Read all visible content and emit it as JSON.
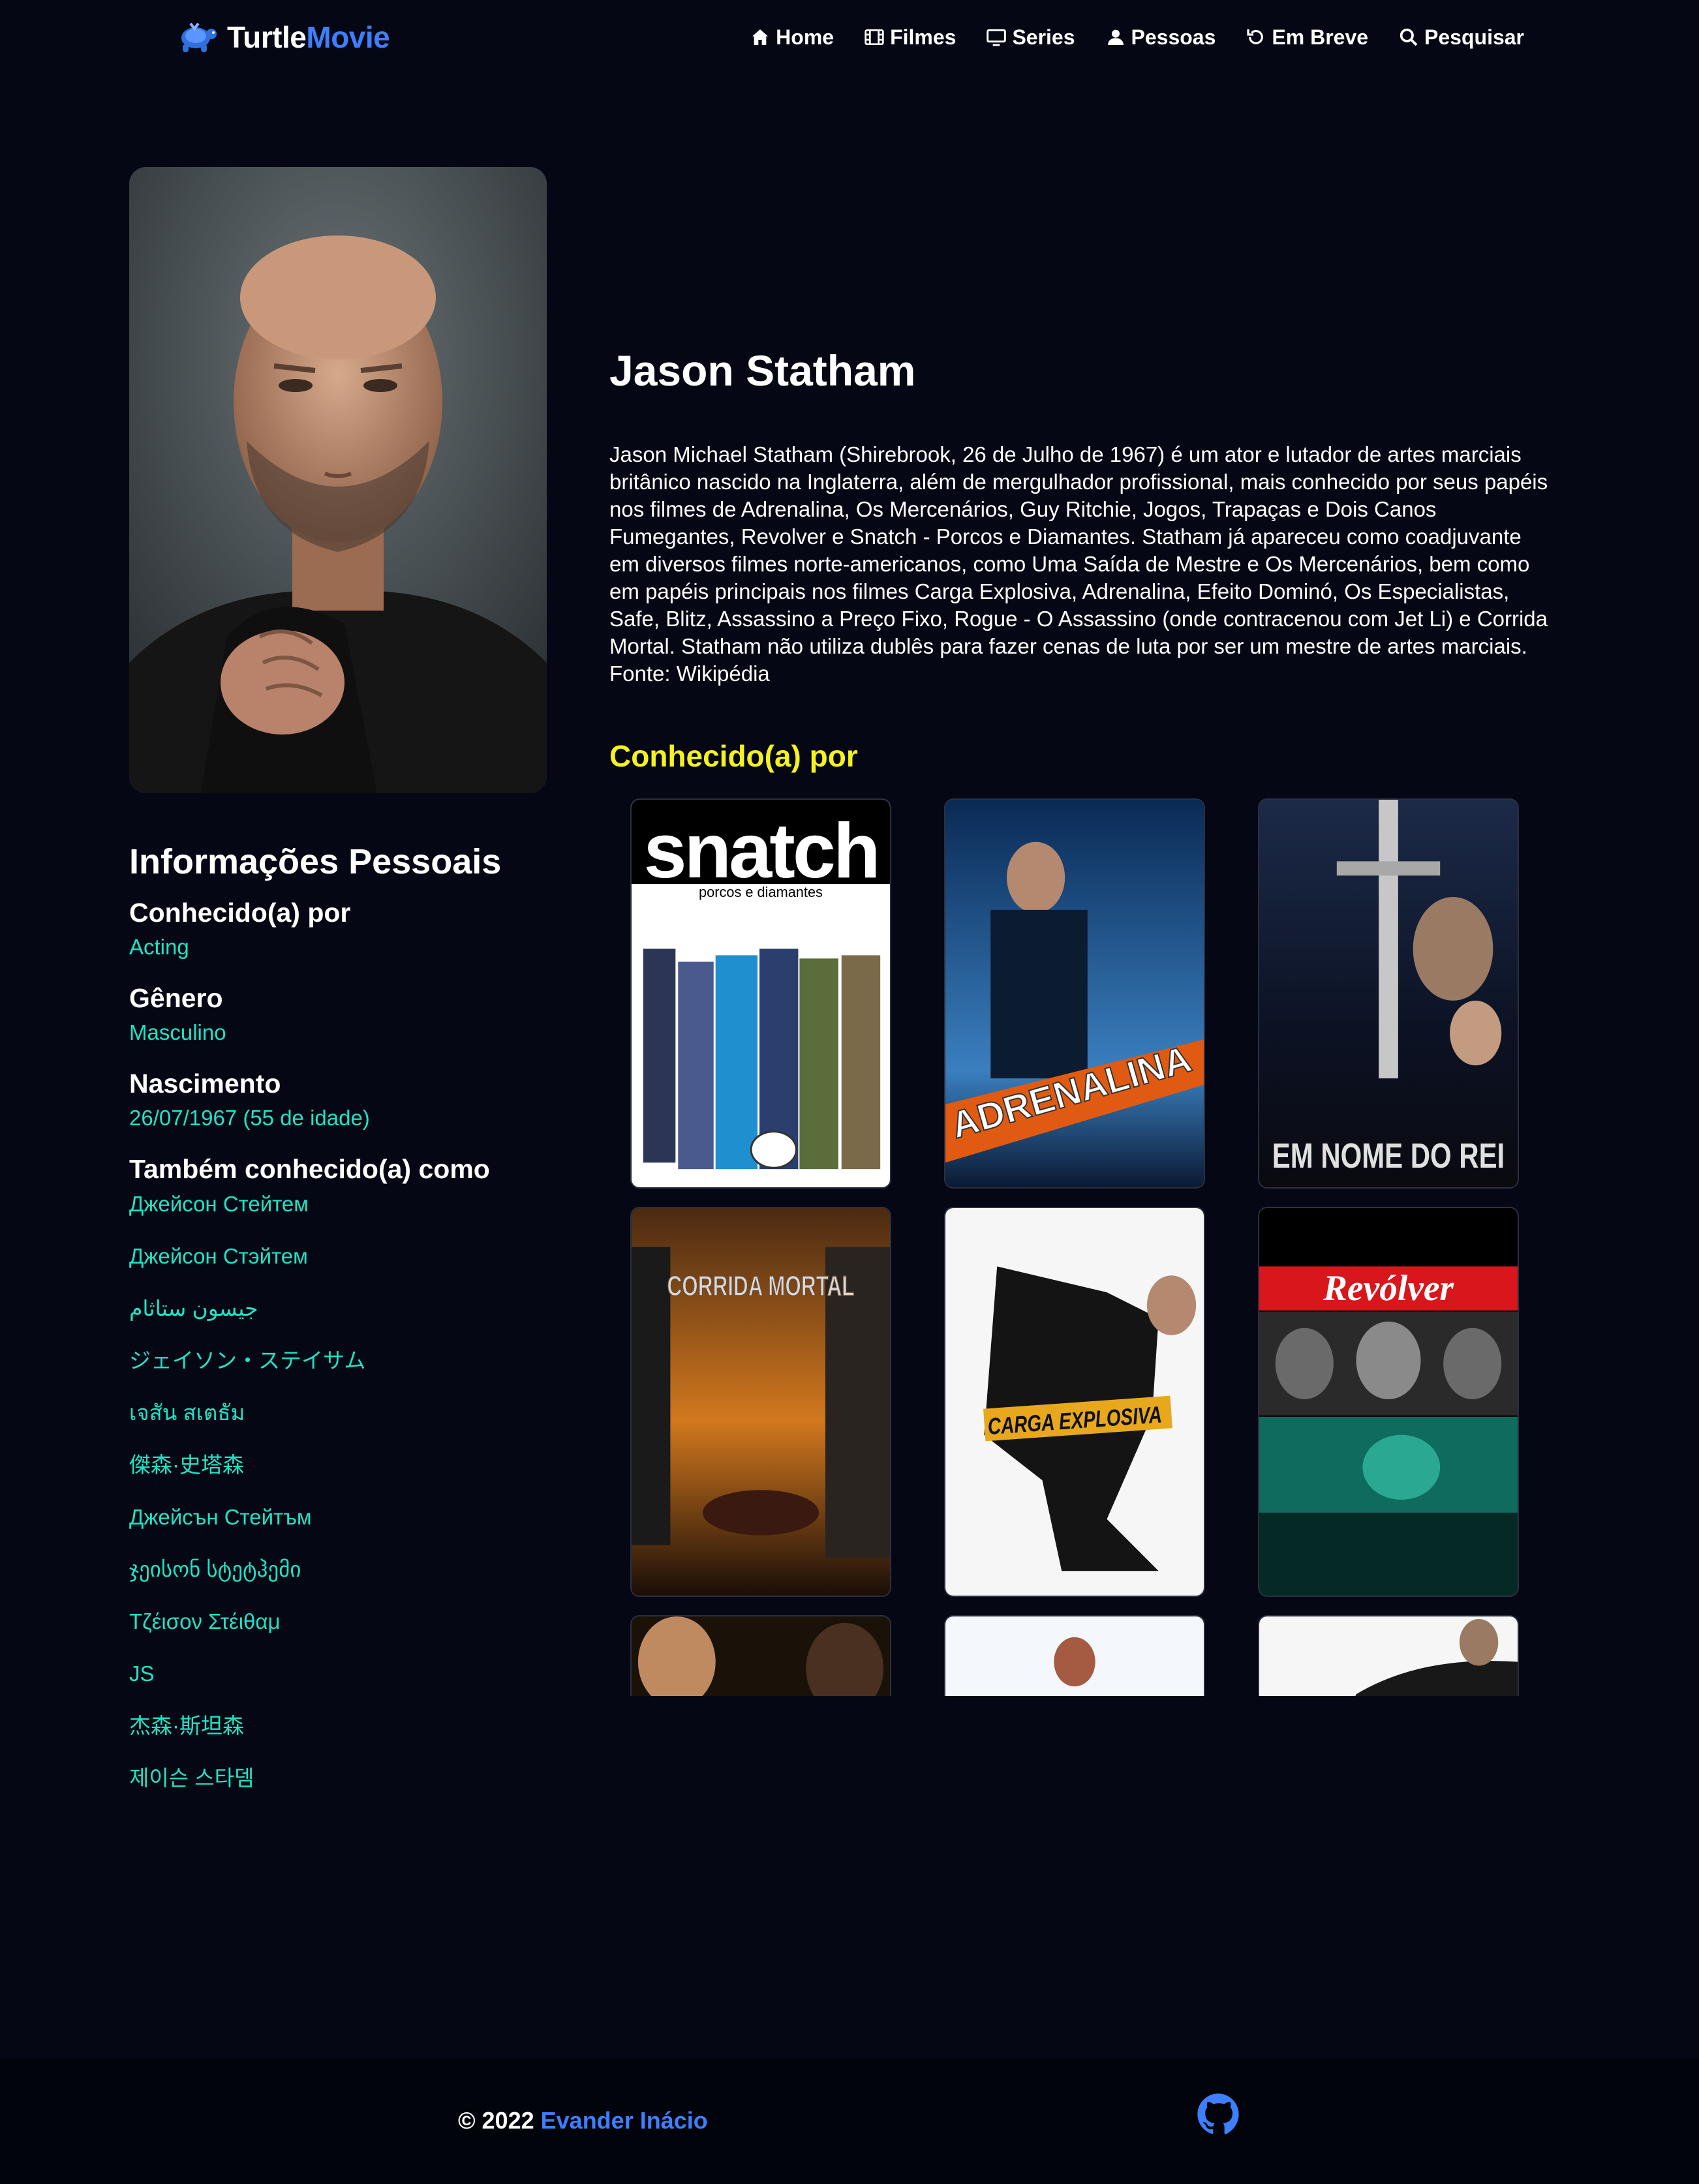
{
  "nav": {
    "logo_part1": "Turtle",
    "logo_part2": "Movie",
    "items": [
      {
        "label": "Home",
        "icon": "home-icon"
      },
      {
        "label": "Filmes",
        "icon": "film-icon"
      },
      {
        "label": "Series",
        "icon": "tv-icon"
      },
      {
        "label": "Pessoas",
        "icon": "person-icon"
      },
      {
        "label": "Em Breve",
        "icon": "history-icon"
      },
      {
        "label": "Pesquisar",
        "icon": "search-icon"
      }
    ]
  },
  "person": {
    "name": "Jason Statham",
    "bio": "Jason Michael Statham (Shirebrook, 26 de Julho de 1967) é um ator e lutador de artes marciais britânico nascido na Inglaterra, além de mergulhador profissional, mais conhecido por seus papéis nos filmes de Adrenalina, Os Mercenários, Guy Ritchie, Jogos, Trapaças e Dois Canos Fumegantes, Revolver e Snatch - Porcos e Diamantes. Statham já apareceu como coadjuvante em diversos filmes norte-americanos, como Uma Saída de Mestre e Os Mercenários, bem como em papéis principais nos filmes Carga Explosiva, Adrenalina, Efeito Dominó, Os Especialistas, Safe, Blitz, Assassino a Preço Fixo, Rogue - O Assassino (onde contracenou com Jet Li) e Corrida Mortal. Statham não utiliza dublês para fazer cenas de luta por ser um mestre de artes marciais. Fonte: Wikipédia"
  },
  "personal_info": {
    "heading": "Informações Pessoais",
    "known_for_label": "Conhecido(a) por",
    "known_for_value": "Acting",
    "gender_label": "Gênero",
    "gender_value": "Masculino",
    "birth_label": "Nascimento",
    "birth_value": "26/07/1967 (55 de idade)",
    "aka_label": "Também conhecido(a) como",
    "aka": [
      "Джейсон Стейтем",
      "Джейсон Стэйтем",
      "جيسون ستاثام",
      "ジェイソン・ステイサム",
      "เจสัน สเตธัม",
      "傑森·史塔森",
      "Джейсън Стейтъм",
      "ჯეისონ სტეტჰემი",
      "Τζέισον Στέιθαμ",
      "JS",
      "杰森·斯坦森",
      "제이슨 스타뎀"
    ]
  },
  "known_for": {
    "heading": "Conhecido(a) por",
    "posters": [
      {
        "title": "snatch",
        "subtitle": "porcos e diamantes"
      },
      {
        "title": "ADRENALINA"
      },
      {
        "title": "EM NOME DO REI"
      },
      {
        "title": "CORRIDA MORTAL"
      },
      {
        "title": "CARGA EXPLOSIVA"
      },
      {
        "title": "Revólver"
      }
    ]
  },
  "footer": {
    "copyright": "© 2022",
    "author": "Evander Inácio",
    "github_icon": "github-icon"
  },
  "colors": {
    "background": "#050814",
    "accent_blue": "#3d7fff",
    "teal": "#20e3c5",
    "yellow": "#f5f31d"
  }
}
